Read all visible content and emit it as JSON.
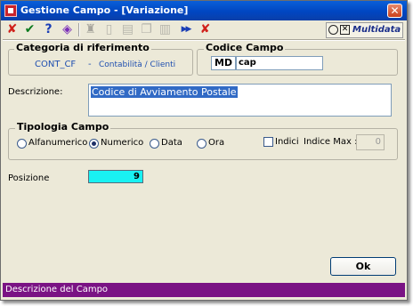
{
  "window": {
    "title": "Gestione Campo - [Variazione]",
    "close": "✕"
  },
  "toolbar": {
    "buttons": [
      {
        "name": "cancel-icon",
        "glyph": "✘",
        "color": "#d0201b"
      },
      {
        "name": "confirm-icon",
        "glyph": "✔",
        "color": "#0b7a1e"
      },
      {
        "name": "help-icon",
        "glyph": "?",
        "color": "#1b3fb6"
      },
      {
        "name": "edit-icon",
        "glyph": "◈",
        "color": "#7a2fb8"
      },
      {
        "name": "binoculars-icon",
        "glyph": "♜",
        "color": "#555555"
      },
      {
        "name": "new-document-icon",
        "glyph": "▯",
        "color": "#777777"
      },
      {
        "name": "clipboard-icon",
        "glyph": "▤",
        "color": "#777777"
      },
      {
        "name": "copy-icon",
        "glyph": "❐",
        "color": "#777777"
      },
      {
        "name": "paste-icon",
        "glyph": "▥",
        "color": "#777777"
      },
      {
        "name": "fast-forward-icon",
        "glyph": "▶▶",
        "color": "#1b3fb6"
      },
      {
        "name": "delete-icon",
        "glyph": "✘",
        "color": "#d0201b"
      }
    ],
    "brand": "Multidata"
  },
  "categoria": {
    "legend": "Categoria di riferimento",
    "code": "CONT_CF",
    "dash": "-",
    "description": "Contabilità / Clienti"
  },
  "codice": {
    "legend": "Codice Campo",
    "prefix": "MD",
    "value": "cap"
  },
  "descrizione": {
    "label": "Descrizione:",
    "value": "Codice di Avviamento Postale"
  },
  "tipologia": {
    "legend": "Tipologia Campo",
    "options": [
      "Alfanumerico",
      "Numerico",
      "Data",
      "Ora"
    ],
    "selected": "Numerico",
    "indici_label": "Indici",
    "indice_max_label": "Indice Max :",
    "indice_max_value": "0"
  },
  "posizione": {
    "label": "Posizione",
    "value": "9",
    "color": "#19f2f2"
  },
  "ok_button": "Ok",
  "status": "Descrizione del Campo"
}
